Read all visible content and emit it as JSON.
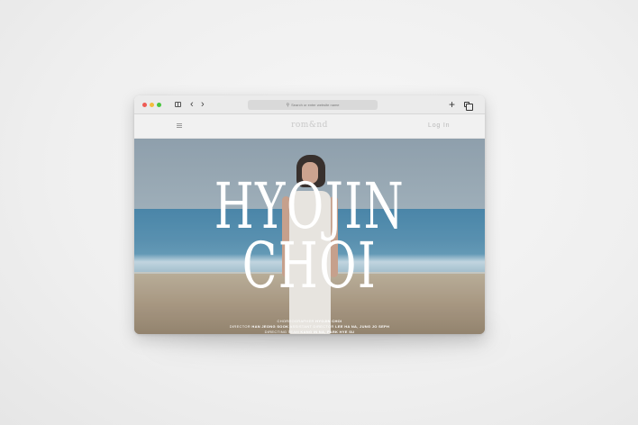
{
  "browser": {
    "url_placeholder": "Search or enter website name",
    "icons": {
      "sidebar": "sidebar-icon",
      "back": "chevron-left-icon",
      "forward": "chevron-right-icon",
      "search": "search-icon",
      "new_tab": "plus-icon",
      "tabs": "tabs-icon"
    },
    "traffic_colors": {
      "close": "#ee5b55",
      "minimize": "#f3bd3e",
      "maximize": "#48c53f"
    }
  },
  "site": {
    "logo": "rom&nd",
    "login": "Log In",
    "menu_icon": "hamburger-icon"
  },
  "hero": {
    "title_line1": "HYOJIN",
    "title_line2": "CHOI",
    "credits": [
      {
        "role": "CHOREOGRAPHER",
        "names": "HYOJIN CHOI"
      },
      {
        "role": "DIRECTOR",
        "names": "HAN JEONG SOOK",
        "role2": "ASSISTANT DIRECTOR",
        "names2": "LEE HA NA, JUNG JO SEPH"
      },
      {
        "role": "DIRECTING TEAM",
        "names": "KANG IN NA, PARK HYE SU"
      }
    ]
  }
}
